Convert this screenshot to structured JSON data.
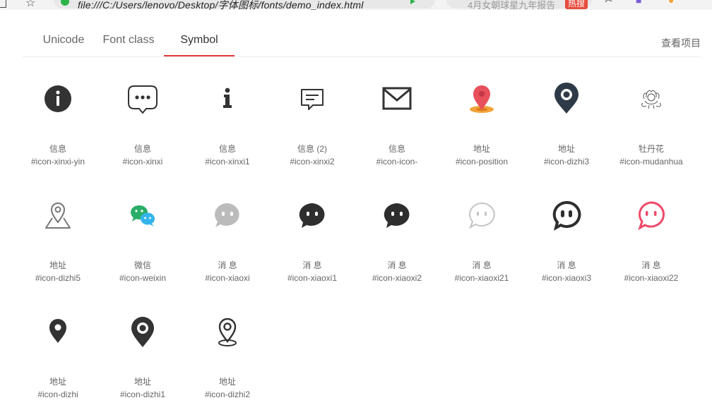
{
  "browser": {
    "url": "file:///C:/Users/lenovo/Desktop/字体图标/fonts/demo_index.html",
    "search_placeholder": "4月女朝球星九年报告",
    "search_badge": "热搜"
  },
  "tabs": [
    {
      "label": "Unicode"
    },
    {
      "label": "Font class"
    },
    {
      "label": "Symbol"
    }
  ],
  "view_project": "查看项目",
  "icons": [
    {
      "name": "信息",
      "code": "#icon-xinxi-yin",
      "icon": "info-circle-filled"
    },
    {
      "name": "信息",
      "code": "#icon-xinxi",
      "icon": "chat-dots-outline"
    },
    {
      "name": "信息",
      "code": "#icon-xinxi1",
      "icon": "info-letter"
    },
    {
      "name": "信息 (2)",
      "code": "#icon-xinxi2",
      "icon": "message-box-outline"
    },
    {
      "name": "信息",
      "code": "#icon-icon-",
      "icon": "envelope"
    },
    {
      "name": "地址",
      "code": "#icon-position",
      "icon": "map-pin-red"
    },
    {
      "name": "地址",
      "code": "#icon-dizhi3",
      "icon": "map-pin-ring"
    },
    {
      "name": "牡丹花",
      "code": "#icon-mudanhua",
      "icon": "peony-flower"
    },
    {
      "name": "地址",
      "code": "#icon-dizhi5",
      "icon": "map-pin-outline"
    },
    {
      "name": "微信",
      "code": "#icon-weixin",
      "icon": "wechat"
    },
    {
      "name": "消 息",
      "code": "#icon-xiaoxi",
      "icon": "chat-bubble-light"
    },
    {
      "name": "消 息",
      "code": "#icon-xiaoxi1",
      "icon": "chat-bubble-dark"
    },
    {
      "name": "消 息",
      "code": "#icon-xiaoxi2",
      "icon": "chat-bubble-dark"
    },
    {
      "name": "消 息",
      "code": "#icon-xiaoxi21",
      "icon": "chat-bubble-outline-light"
    },
    {
      "name": "消 息",
      "code": "#icon-xiaoxi3",
      "icon": "chat-bubble-outline-bold"
    },
    {
      "name": "消 息",
      "code": "#icon-xiaoxi22",
      "icon": "chat-bubble-outline-pink"
    },
    {
      "name": "地址",
      "code": "#icon-dizhi",
      "icon": "map-pin-small"
    },
    {
      "name": "地址",
      "code": "#icon-dizhi1",
      "icon": "map-pin-ring-large"
    },
    {
      "name": "地址",
      "code": "#icon-dizhi2",
      "icon": "map-pin-base-outline"
    }
  ],
  "colors": {
    "accent": "#e4393c",
    "pin_red": "#e8505b",
    "pin_gold": "#f2a33a",
    "wechat_green": "#2aae67",
    "wechat_blue": "#35b4ec",
    "pink": "#f04a6a",
    "dark": "#333333",
    "light_gray": "#bbbbbb"
  }
}
